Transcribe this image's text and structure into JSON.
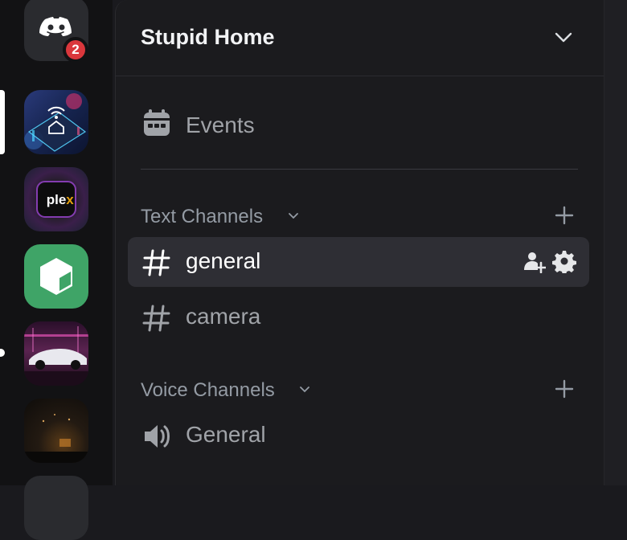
{
  "notification_badge": "2",
  "server": {
    "name": "Stupid Home"
  },
  "events": {
    "label": "Events"
  },
  "categories": [
    {
      "label": "Text Channels"
    },
    {
      "label": "Voice Channels"
    }
  ],
  "text_channels": [
    {
      "name": "general"
    },
    {
      "name": "camera"
    }
  ],
  "voice_channels": [
    {
      "name": "General"
    }
  ],
  "servers": [
    {
      "icon": "discord-home-icon",
      "color": "#2b2d31"
    },
    {
      "icon": "smart-home-server-icon",
      "color": "#1d2b55"
    },
    {
      "icon": "plex-server-icon",
      "color": "#2a1f2e"
    },
    {
      "icon": "cube-server-icon",
      "color": "#3fa467"
    },
    {
      "icon": "car-server-icon",
      "color": "#3a1a3a"
    },
    {
      "icon": "night-scene-server-icon",
      "color": "#1e1812"
    }
  ]
}
